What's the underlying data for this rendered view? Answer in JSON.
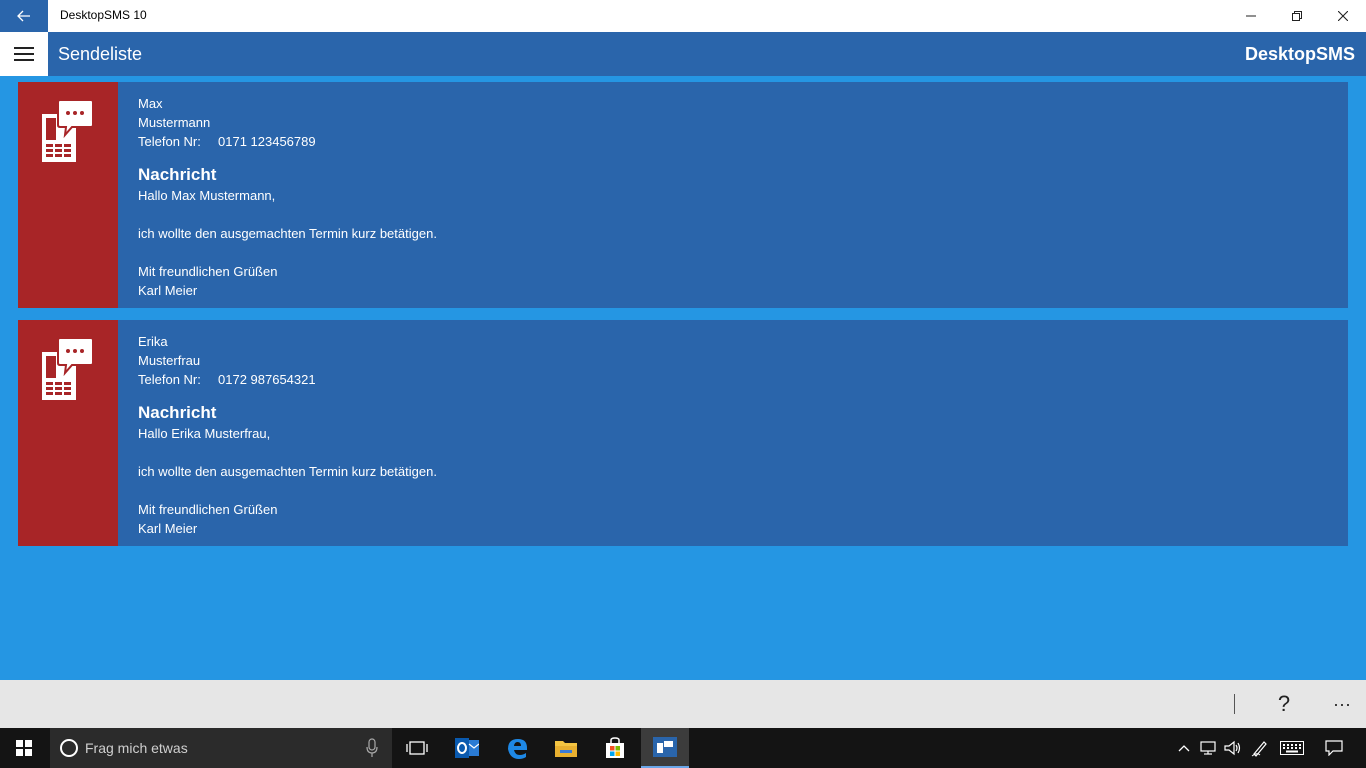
{
  "window": {
    "title": "DesktopSMS 10"
  },
  "header": {
    "page_title": "Sendeliste",
    "brand": "DesktopSMS"
  },
  "messages": [
    {
      "first_name": "Max",
      "last_name": "Mustermann",
      "phone_label": "Telefon Nr:",
      "phone": "0171 123456789",
      "message_heading": "Nachricht",
      "greeting": "Hallo Max Mustermann,",
      "body": "ich wollte den ausgemachten Termin kurz betätigen.",
      "closing": "Mit freundlichen Grüßen",
      "signature": "Karl Meier"
    },
    {
      "first_name": "Erika",
      "last_name": "Musterfrau",
      "phone_label": "Telefon Nr:",
      "phone": "0172 987654321",
      "message_heading": "Nachricht",
      "greeting": "Hallo Erika Musterfrau,",
      "body": "ich wollte den ausgemachten Termin kurz betätigen.",
      "closing": "Mit freundlichen Grüßen",
      "signature": "Karl Meier"
    }
  ],
  "command_bar": {
    "help": "?",
    "more": "···"
  },
  "taskbar": {
    "search_placeholder": "Frag mich etwas",
    "icons": [
      "windows-start-icon",
      "cortana-icon",
      "microphone-icon",
      "task-view-icon",
      "outlook-icon",
      "edge-icon",
      "file-explorer-icon",
      "store-icon",
      "desktopsms-icon"
    ],
    "tray_icons": [
      "chevron-up-icon",
      "network-icon",
      "volume-icon",
      "pen-icon",
      "keyboard-icon",
      "action-center-icon"
    ]
  },
  "colors": {
    "background": "#2596e3",
    "header": "#2a65ab",
    "card": "#2a65ab",
    "icon_tile": "#a82527",
    "command_bar": "#e6e6e6",
    "taskbar": "#141414"
  }
}
